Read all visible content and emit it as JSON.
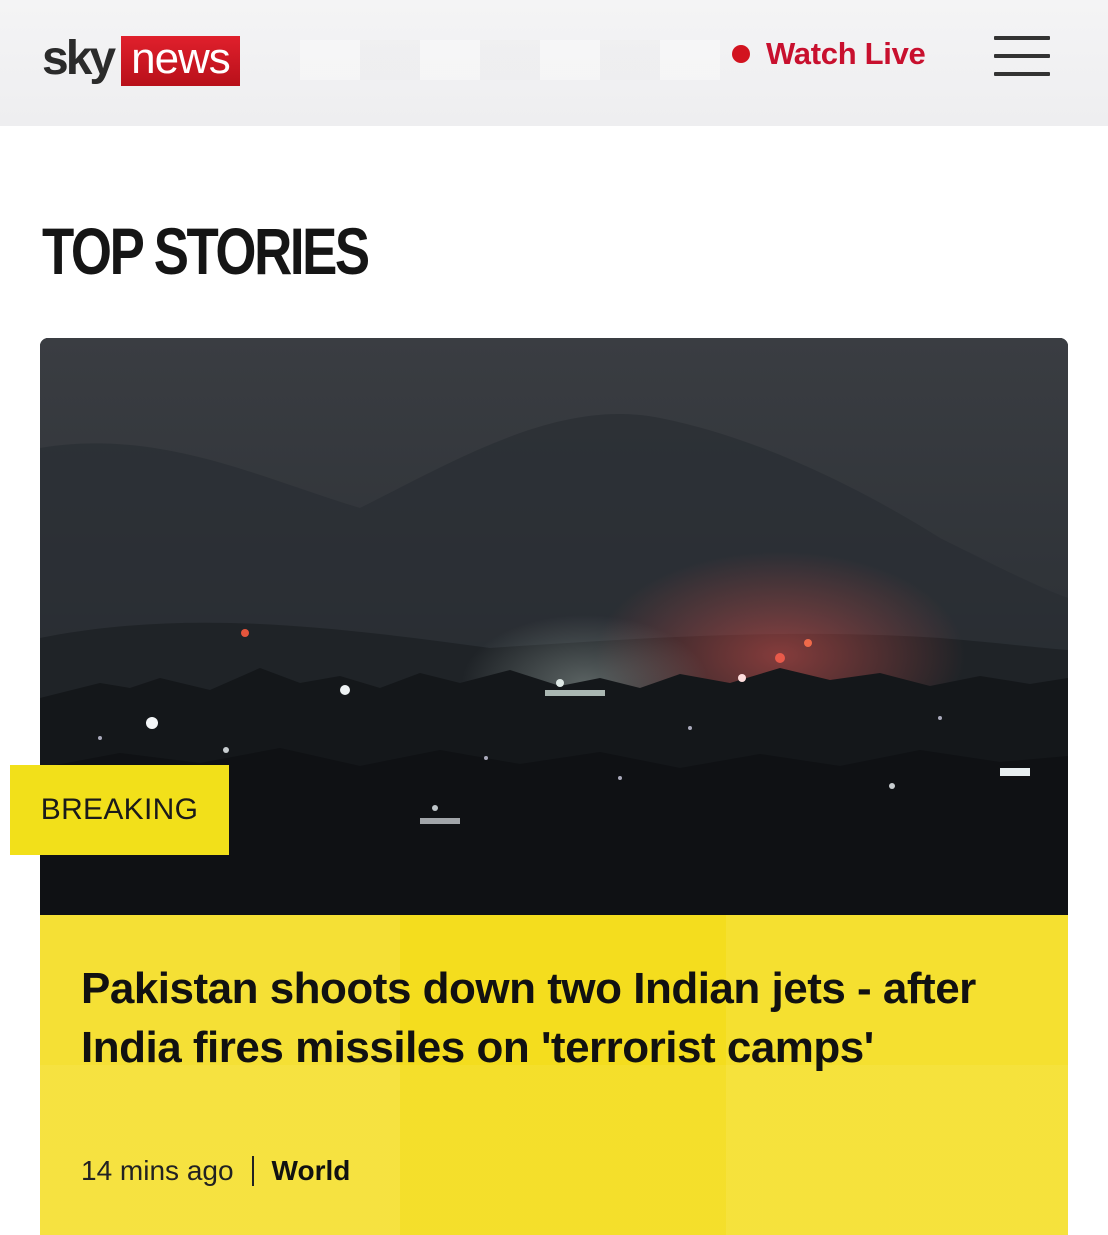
{
  "header": {
    "logo": {
      "sky": "sky",
      "news": "news"
    },
    "watch_live": "Watch Live",
    "brand_red": "#c8102e"
  },
  "section": {
    "title": "TOP STORIES"
  },
  "story": {
    "badge": "BREAKING",
    "badge_color": "#f2e01a",
    "headline": "Pakistan shoots down two Indian jets - after India fires missiles on 'terrorist camps'",
    "timestamp": "14 mins ago",
    "category": "World",
    "card_color": "#f4dd1e"
  }
}
